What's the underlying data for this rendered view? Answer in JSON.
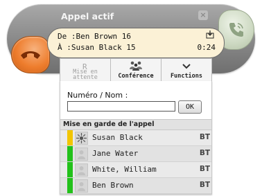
{
  "call": {
    "title": "Appel actif",
    "from_line": "De :Ben Brown 16",
    "to_line": "À :Susan Black 15",
    "timer": "0:24"
  },
  "toolbar": {
    "hold_label": "Mise en attente",
    "conference_label": "Conférence",
    "functions_label": "Functions"
  },
  "dial": {
    "label": "Numéro / Nom :",
    "value": "",
    "ok_label": "OK"
  },
  "hold_list": {
    "header": "Mise en garde de l'appel",
    "items": [
      {
        "name": "Susan Black",
        "tag": "BT",
        "status_color": "#f2c500",
        "icon": "sun-icon"
      },
      {
        "name": "Jane Water",
        "tag": "BT",
        "status_color": "#22c11a",
        "icon": "person-icon"
      },
      {
        "name": "White, William",
        "tag": "BT",
        "status_color": "#22c11a",
        "icon": "person-icon"
      },
      {
        "name": "Ben Brown",
        "tag": "BT",
        "status_color": "#22c11a",
        "icon": "person-icon"
      }
    ]
  },
  "colors": {
    "hangup": "#ee7d2d",
    "answer": "#cdd9c2",
    "info_bg": "#fbf1d6"
  }
}
